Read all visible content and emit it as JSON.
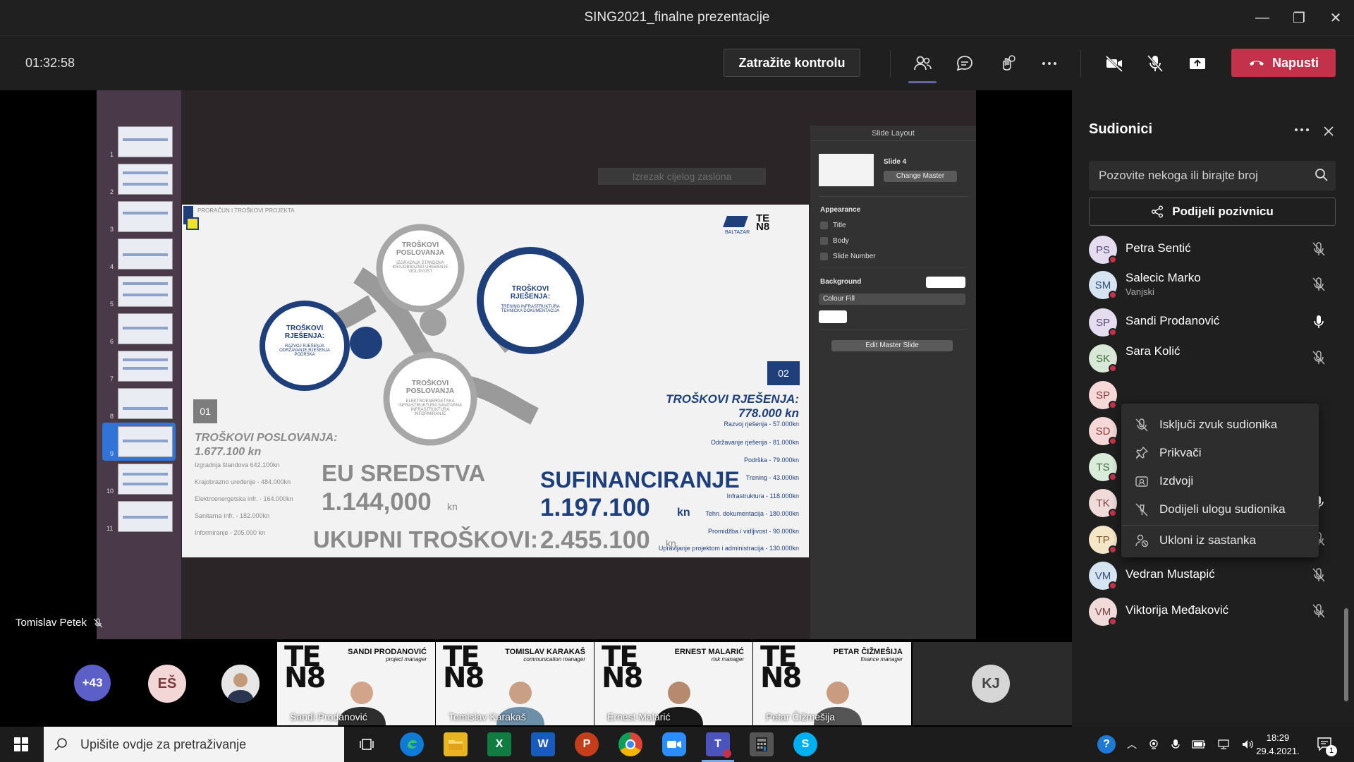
{
  "window": {
    "title": "SING2021_finalne prezentacije",
    "controls": [
      "—",
      "❐",
      "✕"
    ]
  },
  "toolbar": {
    "timer": "01:32:58",
    "request_control": "Zatražite kontrolu",
    "leave": "Napusti",
    "accent": "#6264a7",
    "leave_color": "#c4314b"
  },
  "share": {
    "screen_cut_label": "Izrezak cijelog zaslona",
    "thumb_numbers": [
      "1",
      "2",
      "3",
      "4",
      "5",
      "6",
      "7",
      "8",
      "9",
      "10",
      "11"
    ],
    "selected_thumb": 9,
    "slide_layout": {
      "header": "Slide Layout",
      "slide_name": "Slide 4",
      "change_master": "Change Master",
      "appearance": "Appearance",
      "opt_title": "Title",
      "opt_body": "Body",
      "opt_slide_number": "Slide Number",
      "background": "Background",
      "colour_fill": "Colour Fill",
      "edit_master": "Edit Master Slide"
    },
    "presenter": "Tomislav Petek"
  },
  "slide": {
    "header_label": "PRORAČUN I TROŠKOVI PROJEKTA",
    "logo_text": "BALTAZAR",
    "logo_te": "TE",
    "logo_n8": "N8",
    "circle_top_title": "TROŠKOVI POSLOVANJA",
    "circle_top_sub": "IZGRADNJA ŠTANDOVA KRAJOBRAZNO UREĐENJE VIDLJIVOST",
    "circle_left_title": "TROŠKOVI RJEŠENJA:",
    "circle_left_sub": "RAZVOJ RJEŠENJA ODRŽAVANJE RJEŠENJA PODRŠKA",
    "circle_right_title": "TROŠKOVI RJEŠENJA:",
    "circle_right_sub": "TRENING INFRASTRUKTURA TEHNIČKA DOKUMENTACIJA",
    "circle_bottom_title": "TROŠKOVI POSLOVANJA",
    "circle_bottom_sub": "ELEKTROENERGETSKA INFRASTRUKTURA SANITARNA INFRASTRUKTURA INFORMIRANJE",
    "badge_01": "01",
    "badge_02": "02",
    "left_heading": "TROŠKOVI POSLOVANJA:",
    "left_amount": "1.677.100 kn",
    "left_items": [
      "Izgradnja štandova 642.100kn",
      "Krajobrazno uređenje - 484.000kn",
      "Elektroenergetska infr. - 164.000kn",
      "Sanitarna Infr. - 182.000kn",
      "Informiranje - 205.000 kn"
    ],
    "right_heading": "TROŠKOVI RJEŠENJA:",
    "right_amount": "778.000 kn",
    "right_items": [
      "Razvoj rješenja - 57.000kn",
      "Održavanje rješenja - 81.000kn",
      "Podrška - 79.000kn",
      "Trening - 43.000kn",
      "Infrastruktura - 118.000kn",
      "Tehn. dokumentacija - 180.000kn",
      "Promidžba i vidljivost - 90.000kn",
      "Upravljanje projektom i administracija - 130.000kn"
    ],
    "eu_label": "EU SREDSTVA",
    "eu_value": "1.144,000",
    "eu_unit": "kn",
    "co_label": "SUFINANCIRANJE",
    "co_value": "1.197.100",
    "co_unit": "kn",
    "total_label": "UKUPNI TROŠKOVI:",
    "total_value": "2.455.100",
    "total_unit": "kn"
  },
  "strip": {
    "more_count": "+43",
    "initials_1": "EŠ",
    "initials_kj": "KJ",
    "tiles": [
      {
        "name": "SANDI PRODANOVIĆ",
        "role": "project manager",
        "label": "Sandi Prodanović"
      },
      {
        "name": "TOMISLAV KARAKAŠ",
        "role": "communication manager",
        "label": "Tomislav Karakaš"
      },
      {
        "name": "ERNEST MALARIĆ",
        "role": "risk manager",
        "label": "Ernest Malarić"
      },
      {
        "name": "PETAR ČIŽMEŠIJA",
        "role": "finance manager",
        "label": "Petar Čižmešija"
      }
    ]
  },
  "panel": {
    "title": "Sudionici",
    "search_placeholder": "Pozovite nekoga ili birajte broj",
    "share_invite": "Podijeli pozivnicu",
    "participants": [
      {
        "initials": "PS",
        "name": "Petra Sentić",
        "sub": "",
        "mic": "muted",
        "color": "#e6dcf0",
        "fg": "#5b4a7a"
      },
      {
        "initials": "SM",
        "name": "Salecic Marko",
        "sub": "Vanjski",
        "mic": "muted",
        "color": "#d6e3f0",
        "fg": "#35527a"
      },
      {
        "initials": "SP",
        "name": "Sandi Prodanović",
        "sub": "",
        "mic": "on",
        "color": "#e6dcf0",
        "fg": "#5b4a7a"
      },
      {
        "initials": "SK",
        "name": "Sara Kolić",
        "sub": "Vanjski",
        "mic": "muted",
        "color": "#d9e8d6",
        "fg": "#3f6a3a"
      },
      {
        "initials": "SP",
        "name": "",
        "sub": "",
        "mic": "",
        "color": "#f6d8d8",
        "fg": "#8a3a3a"
      },
      {
        "initials": "SD",
        "name": "",
        "sub": "",
        "mic": "",
        "color": "#f6d8d8",
        "fg": "#8a3a3a"
      },
      {
        "initials": "TS",
        "name": "",
        "sub": "",
        "mic": "",
        "color": "#d9ecd9",
        "fg": "#3a6a3a"
      },
      {
        "initials": "TK",
        "name": "Tomislav Karakaš",
        "sub": "",
        "mic": "on",
        "color": "#f0dada",
        "fg": "#7a4444"
      },
      {
        "initials": "TP",
        "name": "Tomislav Petek",
        "sub": "",
        "mic": "muted",
        "color": "#f5e6c8",
        "fg": "#7a5a2a"
      },
      {
        "initials": "VM",
        "name": "Vedran Mustapić",
        "sub": "",
        "mic": "muted",
        "color": "#d6e3f0",
        "fg": "#35527a"
      },
      {
        "initials": "VM",
        "name": "Viktorija Međaković",
        "sub": "",
        "mic": "muted",
        "color": "#f0dada",
        "fg": "#7a4444"
      }
    ],
    "context_menu": [
      "Isključi zvuk sudionika",
      "Prikvači",
      "Izdvoji",
      "Dodijeli ulogu sudionika",
      "Ukloni iz sastanka"
    ]
  },
  "taskbar": {
    "search_placeholder": "Upišite ovdje za pretraživanje",
    "time": "18:29",
    "date": "29.4.2021.",
    "notification_count": "1",
    "apps": [
      "task-view",
      "edge",
      "file-explorer",
      "excel",
      "word",
      "powerpoint",
      "chrome",
      "zoom",
      "teams",
      "calculator",
      "skype"
    ]
  }
}
